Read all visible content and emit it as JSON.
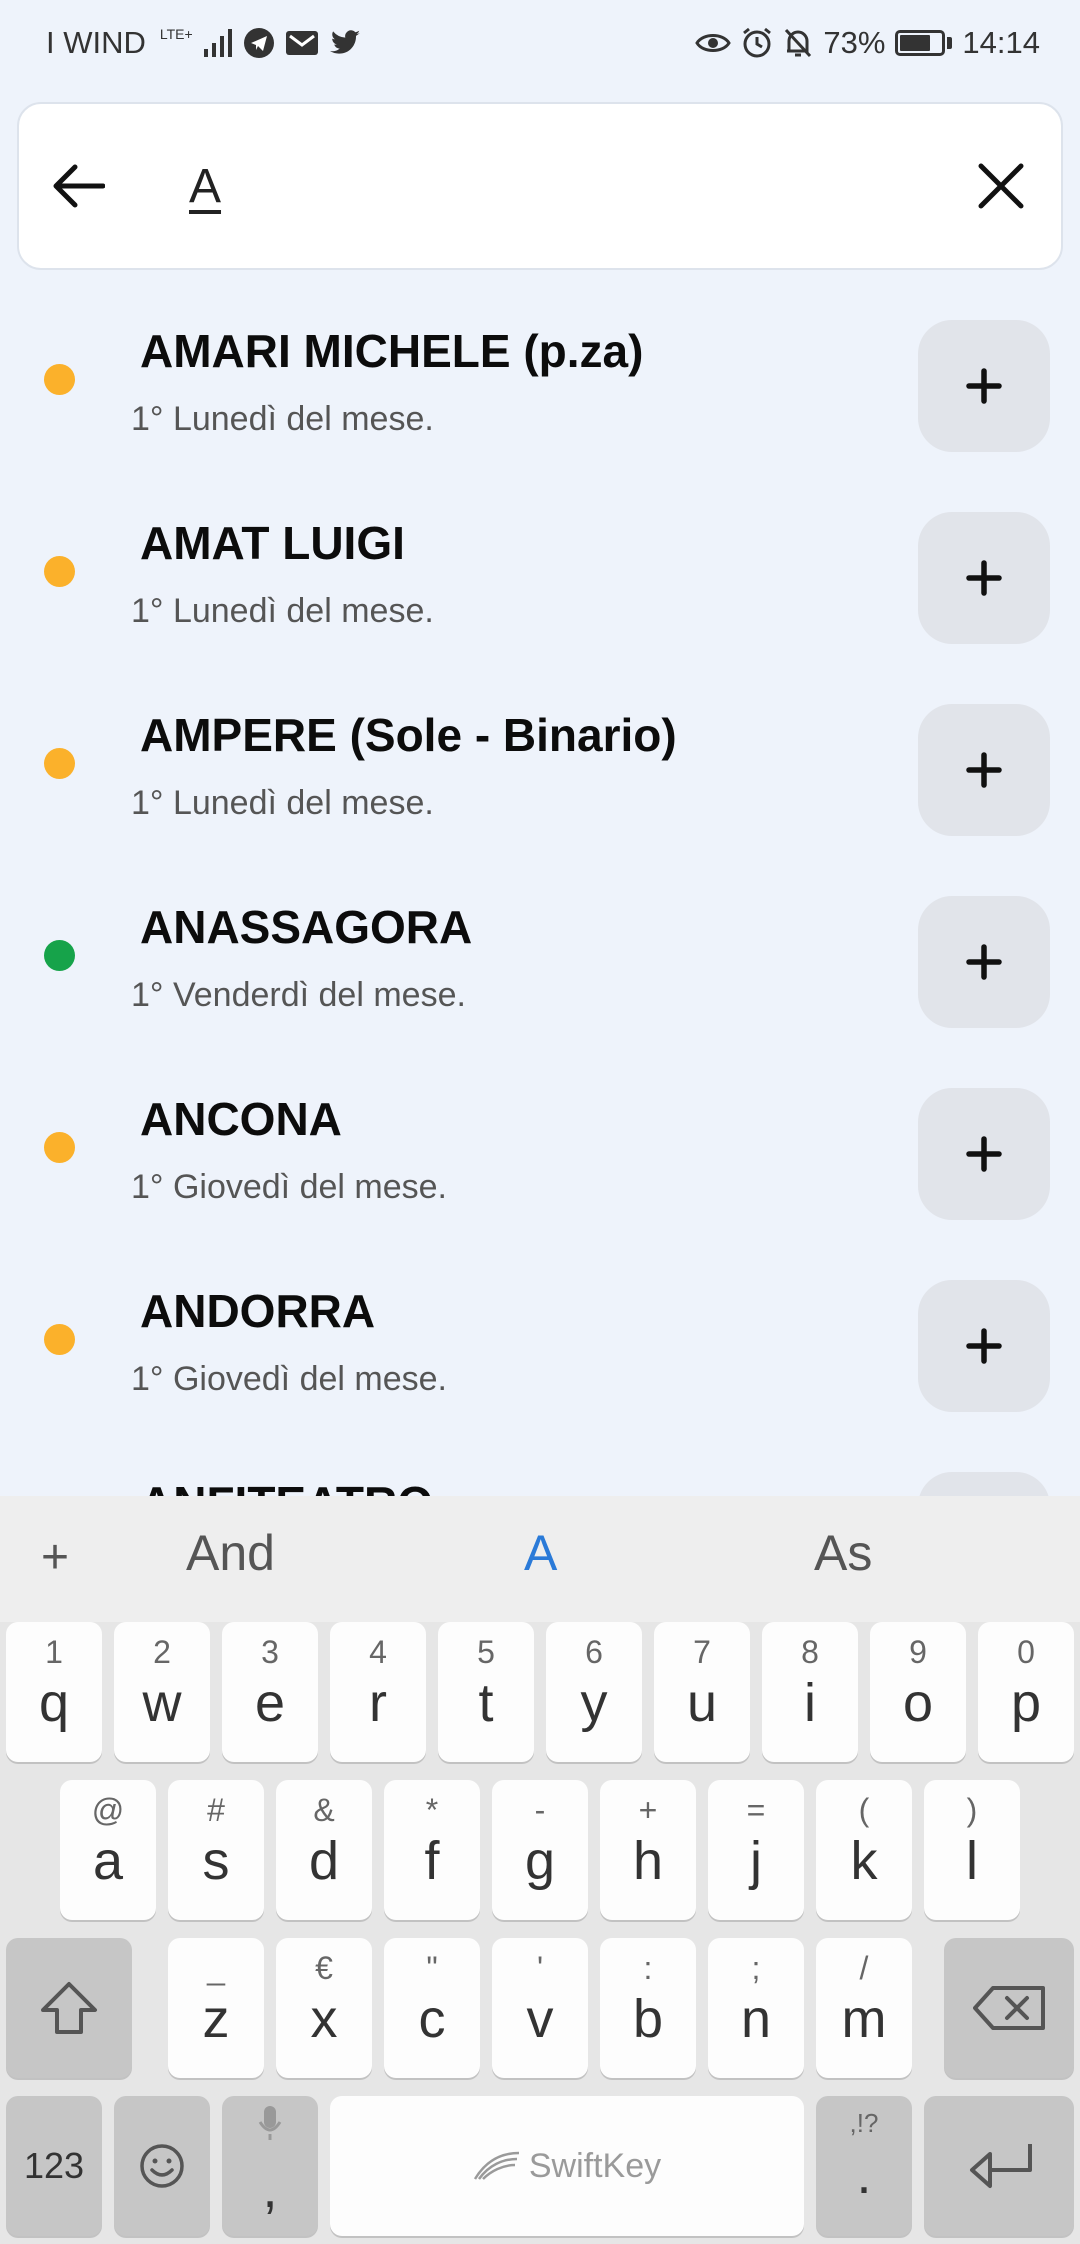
{
  "status_bar": {
    "carrier": "I WIND",
    "network": "LTE+",
    "battery": "73%",
    "battery_fill": 0.73,
    "time": "14:14"
  },
  "search": {
    "value": "A"
  },
  "colors": {
    "dot_orange": "#fbb12b",
    "dot_green": "#16a34a",
    "suggest_active": "#2a7ad8"
  },
  "results": [
    {
      "name": "AMARI MICHELE (p.za)",
      "schedule": "1° Lunedì del mese.",
      "status_color": "orange"
    },
    {
      "name": "AMAT LUIGI",
      "schedule": "1° Lunedì del mese.",
      "status_color": "orange"
    },
    {
      "name": "AMPERE (Sole - Binario)",
      "schedule": "1° Lunedì del mese.",
      "status_color": "orange"
    },
    {
      "name": "ANASSAGORA",
      "schedule": "1° Venderdì del mese.",
      "status_color": "green"
    },
    {
      "name": "ANCONA",
      "schedule": "1° Giovedì del mese.",
      "status_color": "orange"
    },
    {
      "name": "ANDORRA",
      "schedule": "1° Giovedì del mese.",
      "status_color": "orange"
    },
    {
      "name": "ANFITEATRO",
      "schedule": "",
      "status_color": "orange"
    }
  ],
  "add_label": "+",
  "keyboard": {
    "suggestions": [
      "And",
      "A",
      "As"
    ],
    "suggest_plus": "+",
    "row1": [
      {
        "sec": "1",
        "pri": "q"
      },
      {
        "sec": "2",
        "pri": "w"
      },
      {
        "sec": "3",
        "pri": "e"
      },
      {
        "sec": "4",
        "pri": "r"
      },
      {
        "sec": "5",
        "pri": "t"
      },
      {
        "sec": "6",
        "pri": "y"
      },
      {
        "sec": "7",
        "pri": "u"
      },
      {
        "sec": "8",
        "pri": "i"
      },
      {
        "sec": "9",
        "pri": "o"
      },
      {
        "sec": "0",
        "pri": "p"
      }
    ],
    "row2": [
      {
        "sec": "@",
        "pri": "a"
      },
      {
        "sec": "#",
        "pri": "s"
      },
      {
        "sec": "&",
        "pri": "d"
      },
      {
        "sec": "*",
        "pri": "f"
      },
      {
        "sec": "-",
        "pri": "g"
      },
      {
        "sec": "+",
        "pri": "h"
      },
      {
        "sec": "=",
        "pri": "j"
      },
      {
        "sec": "(",
        "pri": "k"
      },
      {
        "sec": ")",
        "pri": "l"
      }
    ],
    "row3": [
      {
        "sec": "_",
        "pri": "z"
      },
      {
        "sec": "€",
        "pri": "x"
      },
      {
        "sec": "\"",
        "pri": "c"
      },
      {
        "sec": "'",
        "pri": "v"
      },
      {
        "sec": ":",
        "pri": "b"
      },
      {
        "sec": ";",
        "pri": "n"
      },
      {
        "sec": "/",
        "pri": "m"
      }
    ],
    "num_key": "123",
    "comma_key": ",",
    "period_sec": ",!?",
    "period_key": ".",
    "space_label": "SwiftKey"
  }
}
